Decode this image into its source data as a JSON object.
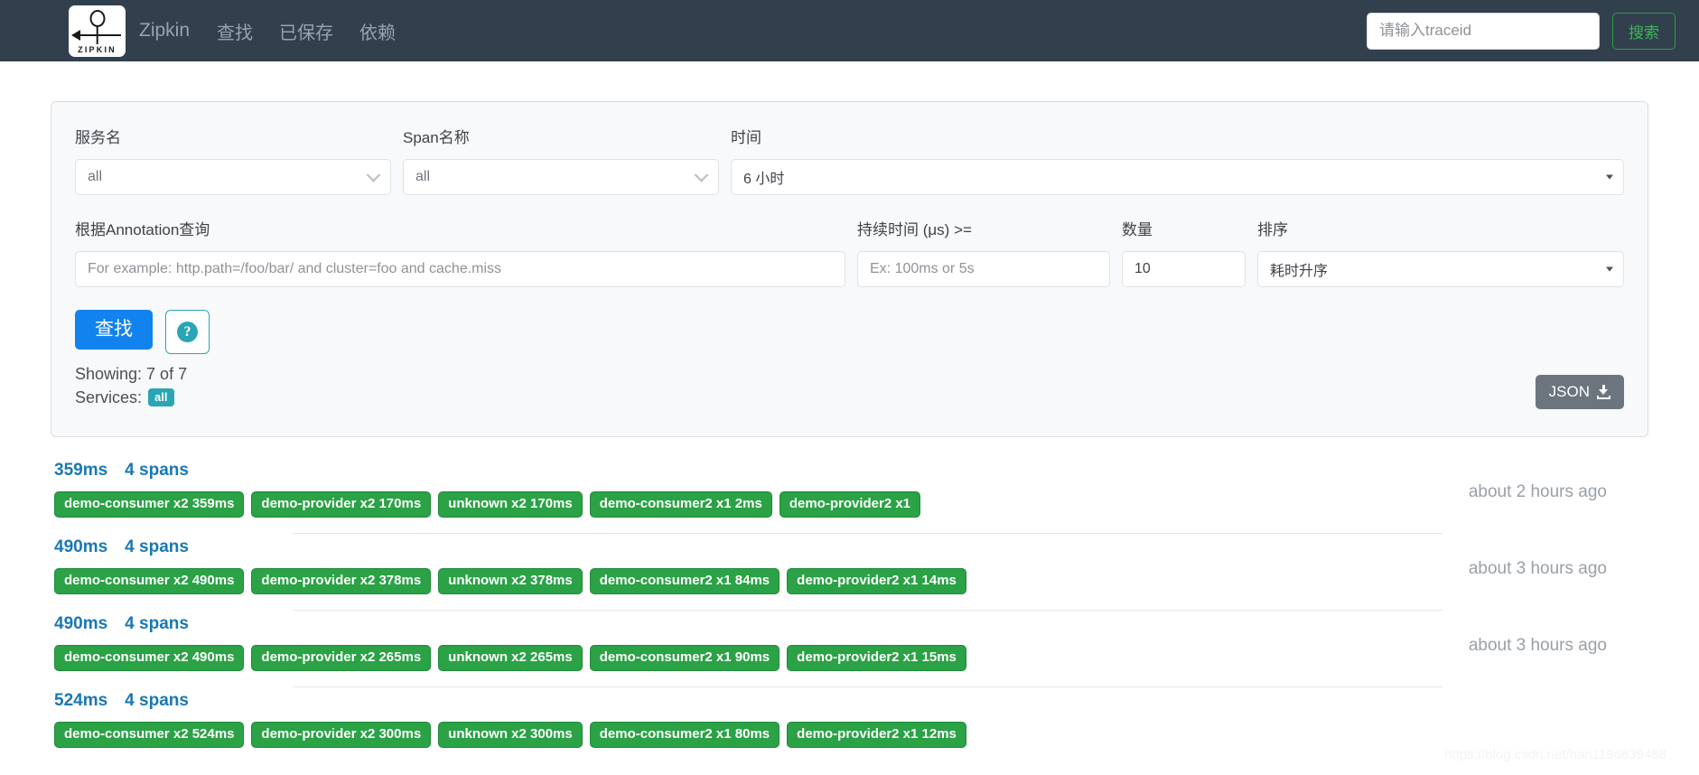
{
  "header": {
    "logo_text": "ZIPKIN",
    "brand": "Zipkin",
    "nav": [
      {
        "label": "查找"
      },
      {
        "label": "已保存"
      },
      {
        "label": "依赖"
      }
    ],
    "traceid_placeholder": "请输入traceid",
    "traceid_value": "",
    "search_button": "搜索",
    "background_color": "#32404e",
    "search_button_color": "#3cb557"
  },
  "search_form": {
    "service": {
      "label": "服务名",
      "value": "all"
    },
    "span": {
      "label": "Span名称",
      "value": "all"
    },
    "time": {
      "label": "时间",
      "value": "6 小时"
    },
    "annotation": {
      "label": "根据Annotation查询",
      "placeholder": "For example: http.path=/foo/bar/ and cluster=foo and cache.miss",
      "value": ""
    },
    "duration": {
      "label": "持续时间 (μs) >=",
      "placeholder": "Ex: 100ms or 5s",
      "value": ""
    },
    "limit": {
      "label": "数量",
      "value": "10"
    },
    "sort": {
      "label": "排序",
      "value": "耗时升序"
    },
    "find_button": "查找",
    "help_icon": "question-mark-icon",
    "showing": "Showing: 7 of 7",
    "services_label": "Services:",
    "services_badge": "all",
    "json_button": "JSON",
    "json_icon": "download-icon",
    "find_button_color": "#1283ee",
    "badge_color": "#2aa5b5",
    "json_button_color": "#6c757d"
  },
  "results": {
    "span_bar_color": "#2aa245",
    "duration_text_color": "#1878b4",
    "traces": [
      {
        "duration": "359ms",
        "spans": "4 spans",
        "timestamp": "about 2 hours ago",
        "bars": [
          "demo-consumer x2 359ms",
          "demo-provider x2 170ms",
          "unknown x2 170ms",
          "demo-consumer2 x1 2ms",
          "demo-provider2 x1"
        ]
      },
      {
        "duration": "490ms",
        "spans": "4 spans",
        "timestamp": "about 3 hours ago",
        "bars": [
          "demo-consumer x2 490ms",
          "demo-provider x2 378ms",
          "unknown x2 378ms",
          "demo-consumer2 x1 84ms",
          "demo-provider2 x1 14ms"
        ]
      },
      {
        "duration": "490ms",
        "spans": "4 spans",
        "timestamp": "about 3 hours ago",
        "bars": [
          "demo-consumer x2 490ms",
          "demo-provider x2 265ms",
          "unknown x2 265ms",
          "demo-consumer2 x1 90ms",
          "demo-provider2 x1 15ms"
        ]
      },
      {
        "duration": "524ms",
        "spans": "4 spans",
        "timestamp": "",
        "bars": [
          "demo-consumer x2 524ms",
          "demo-provider x2 300ms",
          "unknown x2 300ms",
          "demo-consumer2 x1 80ms",
          "demo-provider2 x1 12ms"
        ]
      }
    ]
  },
  "watermark": "https://blog.csdn.net/han1196639488"
}
